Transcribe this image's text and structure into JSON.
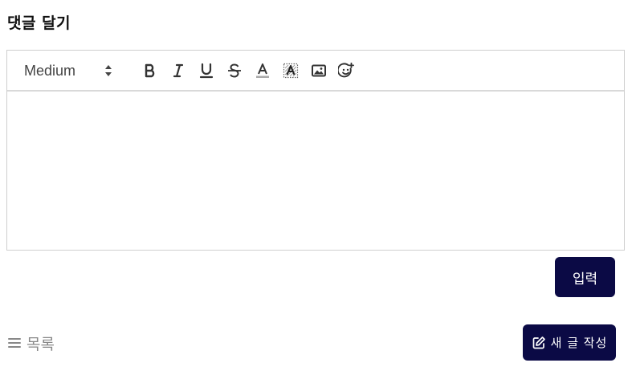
{
  "comment_section": {
    "title": "댓글 달기"
  },
  "toolbar": {
    "font_size_value": "Medium",
    "icons": {
      "bold": "bold-icon",
      "italic": "italic-icon",
      "underline": "underline-icon",
      "strikethrough": "strikethrough-icon",
      "text_color": "text-color-icon",
      "highlight": "highlight-icon",
      "image": "image-icon",
      "emoji": "emoji-add-icon"
    }
  },
  "actions": {
    "submit_label": "입력",
    "list_label": "목록",
    "new_post_label": "새 글 작성"
  },
  "colors": {
    "primary": "#0b0a45",
    "muted_text": "#888888",
    "border": "#cfcfcf"
  }
}
